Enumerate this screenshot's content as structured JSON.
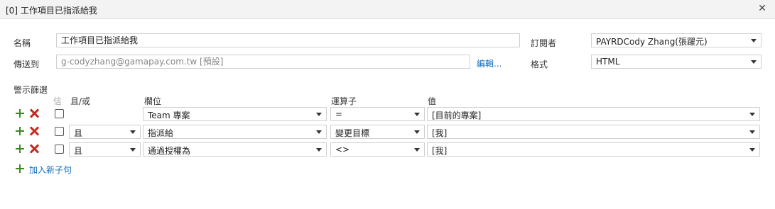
{
  "window": {
    "title": "[0] 工作項目已指派給我",
    "close_icon": "close-icon"
  },
  "form": {
    "name_label": "名稱",
    "name_value": "工作項目已指派給我",
    "send_to_label": "傳送到",
    "send_to_value": "g-codyzhang@gamapay.com.tw [預設]",
    "edit_link": "編輯...",
    "subscriber_label": "訂閱者",
    "subscriber_value": "PAYRDCody Zhang(張躍元)",
    "format_label": "格式",
    "format_value": "HTML"
  },
  "filters": {
    "section_label": "警示篩選",
    "headers": {
      "group": "信",
      "and_or": "且/或",
      "field": "欄位",
      "operator": "運算子",
      "value": "值"
    },
    "rows": [
      {
        "and_or": "",
        "field": "Team 專案",
        "operator": "=",
        "value": "[目前的專案]"
      },
      {
        "and_or": "且",
        "field": "指派給",
        "operator": "變更目標",
        "value": "[我]"
      },
      {
        "and_or": "且",
        "field": "通過授權為",
        "operator": "<>",
        "value": "[我]"
      }
    ],
    "add_clause": "加入新子句"
  },
  "colors": {
    "accent": "#106ebe",
    "add_green": "#3c8a1e",
    "delete_red": "#c8281e"
  }
}
